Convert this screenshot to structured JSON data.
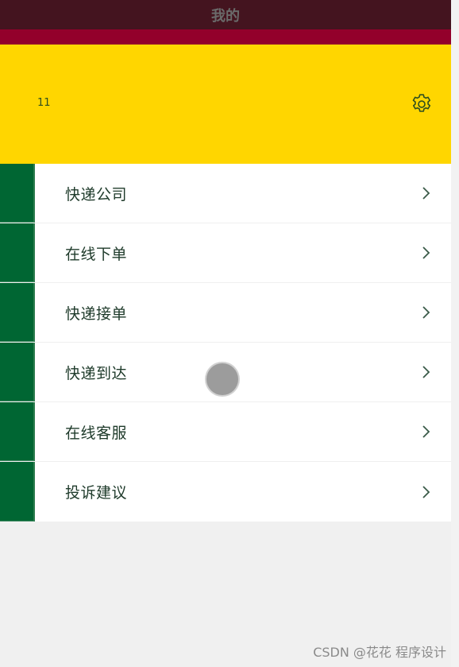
{
  "header": {
    "title": "我的"
  },
  "profile": {
    "user_id": "11",
    "settings_icon": "gear-icon",
    "accent_color": "#ffd600"
  },
  "menu": {
    "items": [
      {
        "label": "快递公司",
        "icon": "chevron-right-icon"
      },
      {
        "label": "在线下单",
        "icon": "chevron-right-icon"
      },
      {
        "label": "快递接单",
        "icon": "chevron-right-icon"
      },
      {
        "label": "快递到达",
        "icon": "chevron-right-icon"
      },
      {
        "label": "在线客服",
        "icon": "chevron-right-icon"
      },
      {
        "label": "投诉建议",
        "icon": "chevron-right-icon"
      }
    ]
  },
  "watermark": "CSDN @花花 程序设计",
  "colors": {
    "title_bar": "#44141f",
    "title_strip": "#93002b",
    "menu_marker": "#006633"
  }
}
